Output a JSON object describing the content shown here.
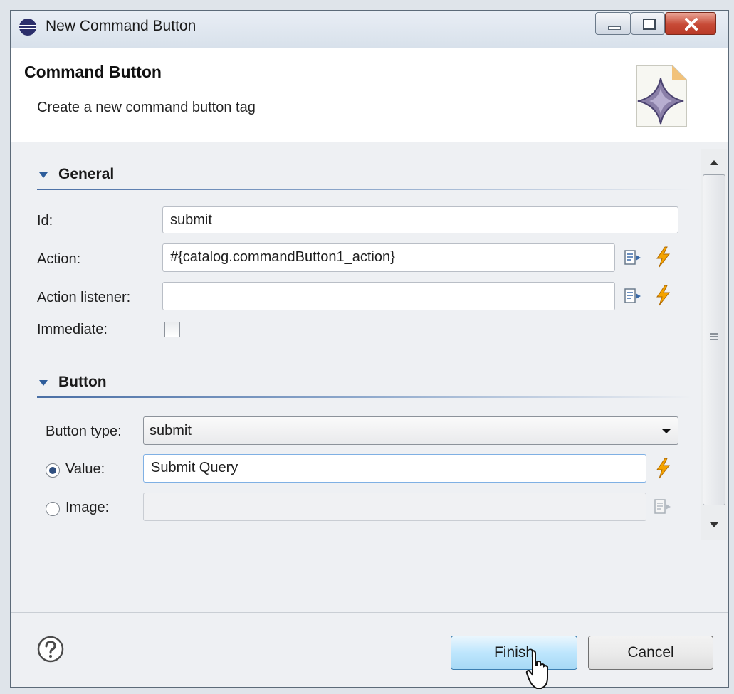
{
  "window": {
    "title": "New Command Button"
  },
  "header": {
    "title": "Command Button",
    "description": "Create a new command button tag"
  },
  "sections": {
    "general": {
      "title": "General"
    },
    "button": {
      "title": "Button"
    }
  },
  "fields": {
    "id": {
      "label": "Id:",
      "value": "submit"
    },
    "action": {
      "label": "Action:",
      "value": "#{catalog.commandButton1_action}"
    },
    "action_listener": {
      "label": "Action listener:",
      "value": ""
    },
    "immediate": {
      "label": "Immediate:",
      "checked": false
    },
    "button_type": {
      "label": "Button type:",
      "value": "submit"
    },
    "value": {
      "label": "Value:",
      "value": "Submit Query",
      "selected": true
    },
    "image": {
      "label": "Image:",
      "value": "",
      "selected": false
    }
  },
  "footer": {
    "finish_label": "Finish",
    "cancel_label": "Cancel"
  },
  "icons": {
    "app": "eclipse-icon",
    "wizard": "wizard-banner-icon",
    "edit": "edit-binding-icon",
    "event": "lightning-icon",
    "help": "help-icon"
  },
  "colors": {
    "accent": "#2d5d9b",
    "lightning": "#f4a300"
  }
}
